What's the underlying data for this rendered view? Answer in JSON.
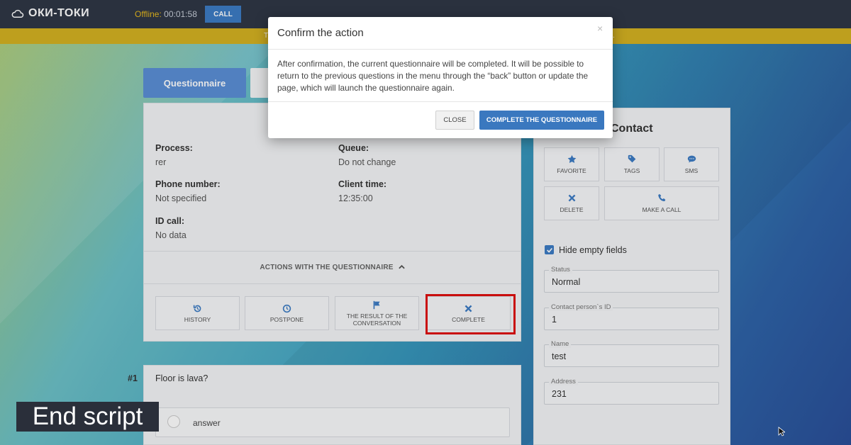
{
  "topbar": {
    "logo_text": "ОКИ-ТОКИ",
    "status_label": "Offline:",
    "status_timer": "00:01:58",
    "call_label": "CALL"
  },
  "banner": {
    "left_text": "T",
    "right_text": "."
  },
  "tabs": {
    "questionnaire": "Questionnaire"
  },
  "main": {
    "fields": [
      {
        "label": "Process:",
        "value": "rer"
      },
      {
        "label": "Queue:",
        "value": "Do not change"
      },
      {
        "label": "Phone number:",
        "value": "Not specified"
      },
      {
        "label": "Client time:",
        "value": "12:35:00"
      },
      {
        "label": "ID call:",
        "value": "No data"
      }
    ],
    "actions_title": "ACTIONS WITH THE QUESTIONNAIRE",
    "actions": [
      {
        "label": "HISTORY",
        "icon": "history-icon"
      },
      {
        "label": "POSTPONE",
        "icon": "clock-icon"
      },
      {
        "label": "THE RESULT OF THE CONVERSATION",
        "icon": "flag-icon"
      },
      {
        "label": "COMPLETE",
        "icon": "close-icon"
      }
    ]
  },
  "question": {
    "number": "#1",
    "text": "Floor is lava?",
    "answer": "answer"
  },
  "contact": {
    "title": "Contact",
    "buttons": [
      {
        "label": "FAVORITE",
        "icon": "star-icon"
      },
      {
        "label": "TAGS",
        "icon": "tags-icon"
      },
      {
        "label": "SMS",
        "icon": "chat-icon"
      },
      {
        "label": "DELETE",
        "icon": "delete-icon"
      },
      {
        "label": "MAKE A CALL",
        "icon": "phone-icon"
      }
    ],
    "hide_empty": "Hide empty fields",
    "fields": [
      {
        "label": "Status",
        "value": "Normal"
      },
      {
        "label": "Contact person`s ID",
        "value": "1"
      },
      {
        "label": "Name",
        "value": "test"
      },
      {
        "label": "Address",
        "value": "231"
      }
    ]
  },
  "modal": {
    "title": "Confirm the action",
    "close_x": "×",
    "body": "After confirmation, the current questionnaire will be completed. It will be possible to return to the previous questions in the menu through the “back” button or update the page, which will launch the questionnaire again.",
    "close_label": "CLOSE",
    "complete_label": "COMPLETE THE QUESTIONNAIRE"
  },
  "overlay": {
    "end_script": "End script"
  },
  "colors": {
    "accent": "#3d7cc4",
    "banner": "#d4b122",
    "topbar": "#2f3746",
    "highlight": "#e01010"
  }
}
